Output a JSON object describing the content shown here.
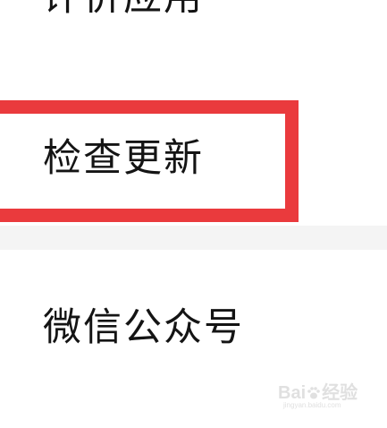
{
  "menu": {
    "items": [
      {
        "id": "rate",
        "label": "评价应用"
      },
      {
        "id": "update",
        "label": "检查更新",
        "highlighted": true
      },
      {
        "id": "wechat",
        "label": "微信公众号"
      }
    ]
  },
  "highlight": {
    "color": "#ea3a3d"
  },
  "divider": {
    "color": "#f4f4f4"
  },
  "watermark": {
    "logo_text_a": "Bai",
    "logo_text_b": "经验",
    "url": "jingyan.baidu.com"
  }
}
